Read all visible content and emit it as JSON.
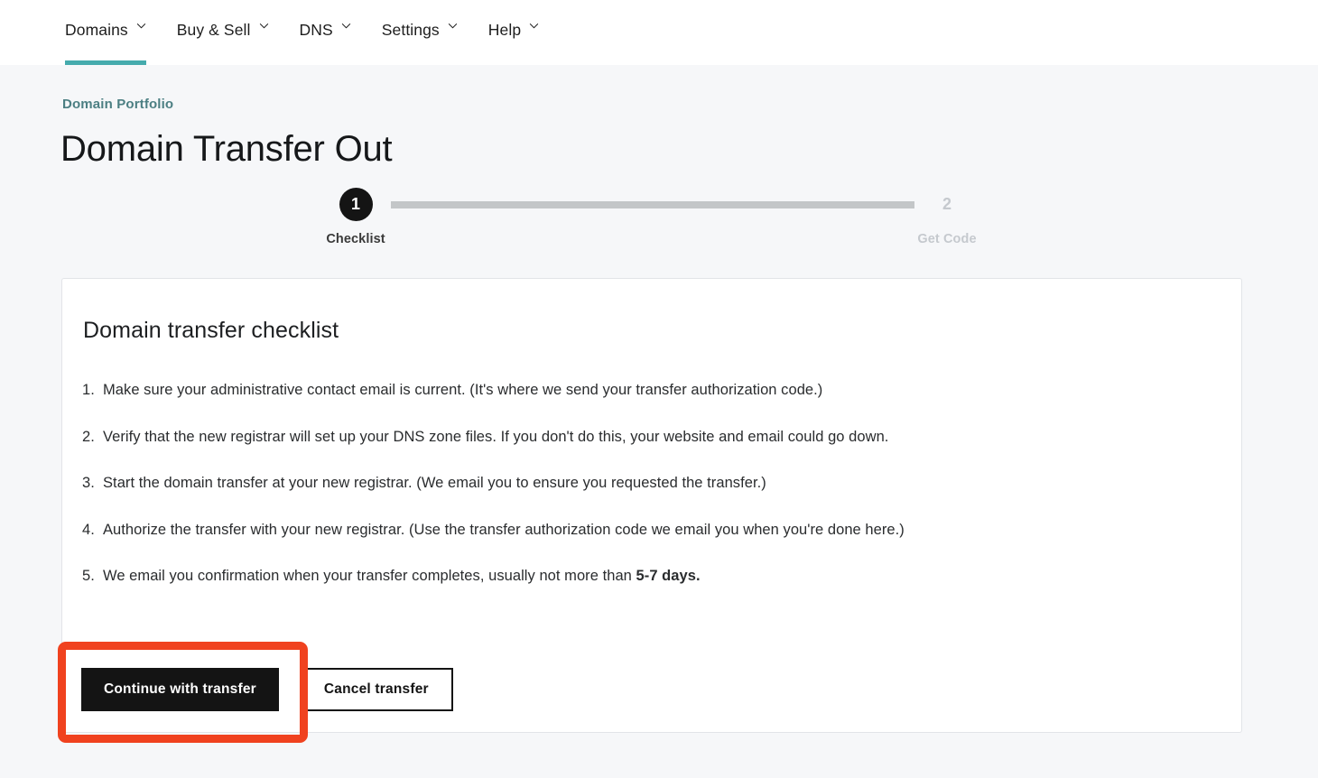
{
  "nav": {
    "items": [
      {
        "label": "Domains",
        "has_chevron": true,
        "active": true
      },
      {
        "label": "Buy & Sell",
        "has_chevron": true,
        "active": false
      },
      {
        "label": "DNS",
        "has_chevron": true,
        "active": false
      },
      {
        "label": "Settings",
        "has_chevron": true,
        "active": false
      },
      {
        "label": "Help",
        "has_chevron": true,
        "active": false
      }
    ],
    "active_underline_color": "#45abad",
    "chevron_icon": "chevron-down-icon"
  },
  "header": {
    "breadcrumb": "Domain Portfolio",
    "title": "Domain Transfer Out"
  },
  "stepper": {
    "steps": [
      {
        "number": "1",
        "label": "Checklist",
        "state": "active"
      },
      {
        "number": "2",
        "label": "Get Code",
        "state": "inactive"
      }
    ],
    "bar_color": "#c3c6c8",
    "active_color": "#141414",
    "inactive_color": "#c5c9ce"
  },
  "card": {
    "title": "Domain transfer checklist",
    "checklist": [
      {
        "number": "1.",
        "text": "Make sure your administrative contact email is current. (It's where we send your transfer authorization code.)",
        "bold_suffix": ""
      },
      {
        "number": "2.",
        "text": "Verify that the new registrar will set up your DNS zone files. If you don't do this, your website and email could go down.",
        "bold_suffix": ""
      },
      {
        "number": "3.",
        "text": "Start the domain transfer at your new registrar. (We email you to ensure you requested the transfer.)",
        "bold_suffix": ""
      },
      {
        "number": "4.",
        "text": "Authorize the transfer with your new registrar. (Use the transfer authorization code we email you when you're done here.)",
        "bold_suffix": ""
      },
      {
        "number": "5.",
        "text": "We email you confirmation when your transfer completes, usually not more than ",
        "bold_suffix": "5-7 days."
      }
    ]
  },
  "actions": {
    "primary_label": "Continue with transfer",
    "secondary_label": "Cancel transfer"
  },
  "annotation": {
    "highlight_color": "#f0421f",
    "target": "continue-with-transfer-button"
  }
}
